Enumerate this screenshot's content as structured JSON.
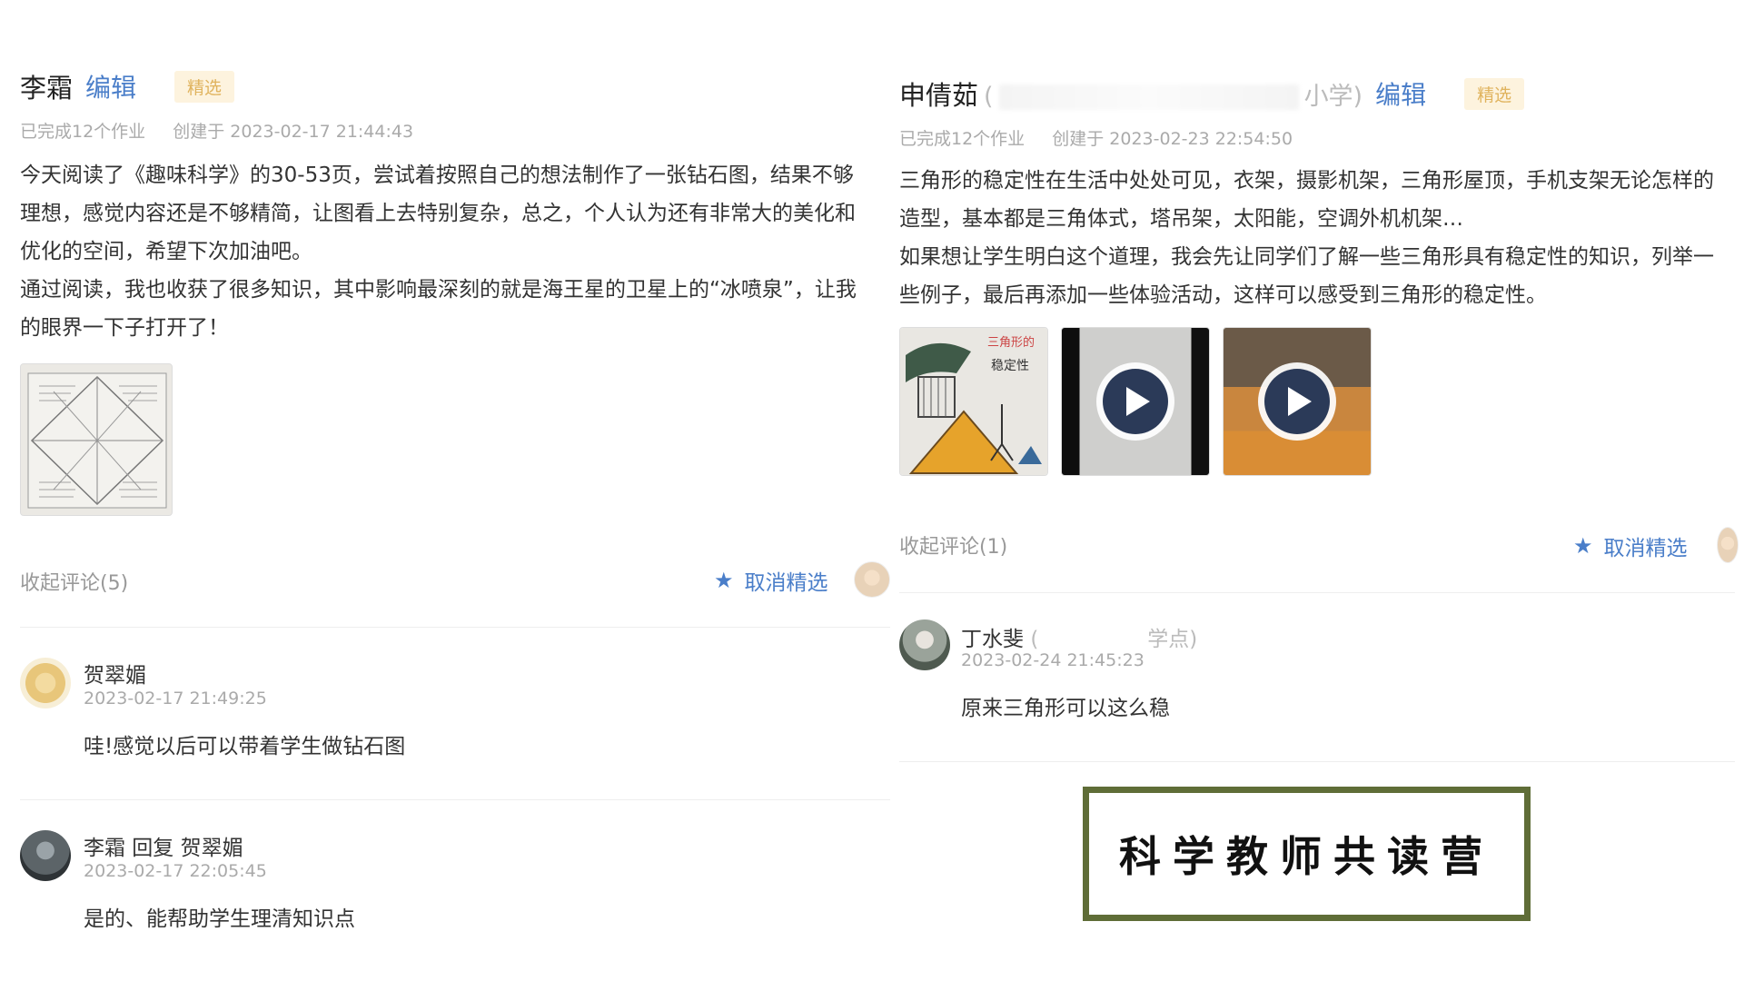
{
  "left": {
    "author": "李霜",
    "edit_label": "编辑",
    "badge": "精选",
    "completed": "已完成12个作业",
    "created": "创建于 2023-02-17 21:44:43",
    "paragraphs": [
      "今天阅读了《趣味科学》的30-53页，尝试着按照自己的想法制作了一张钻石图，结果不够理想，感觉内容还是不够精简，让图看上去特别复杂，总之，个人认为还有非常大的美化和优化的空间，希望下次加油吧。",
      "通过阅读，我也收获了很多知识，其中影响最深刻的就是海王星的卫星上的“冰喷泉”，让我的眼界一下子打开了！"
    ],
    "collapse_label": "收起评论(5)",
    "unfeature_label": "取消精选",
    "comments": [
      {
        "name": "贺翠媚",
        "time": "2023-02-17 21:49:25",
        "text": "哇!感觉以后可以带着学生做钻石图"
      },
      {
        "name": "李霜 回复 贺翠媚",
        "time": "2023-02-17 22:05:45",
        "text": "是的、能帮助学生理清知识点"
      }
    ]
  },
  "right": {
    "author": "申倩茹",
    "org_start": "(",
    "org_end": "小学)",
    "edit_label": "编辑",
    "badge": "精选",
    "completed": "已完成12个作业",
    "created": "创建于 2023-02-23 22:54:50",
    "paragraphs": [
      "三角形的稳定性在生活中处处可见，衣架，摄影机架，三角形屋顶，手机支架无论怎样的造型，基本都是三角体式，塔吊架，太阳能，空调外机机架…",
      "如果想让学生明白这个道理，我会先让同学们了解一些三角形具有稳定性的知识，列举一些例子，最后再添加一些体验活动，这样可以感受到三角形的稳定性。"
    ],
    "collapse_label": "收起评论(1)",
    "unfeature_label": "取消精选",
    "comments": [
      {
        "name": "丁水斐",
        "org_start": "(",
        "org_end": "学点)",
        "time": "2023-02-24 21:45:23",
        "text": "原来三角形可以这么稳"
      }
    ]
  },
  "stamp": {
    "text": "科学教师共读营"
  },
  "colors": {
    "link": "#4a7ec9",
    "badge_text": "#e0b35d",
    "badge_bg": "#fdf3de",
    "stamp_border": "#5f6d37"
  },
  "icons": [
    "star-icon",
    "play-icon"
  ]
}
